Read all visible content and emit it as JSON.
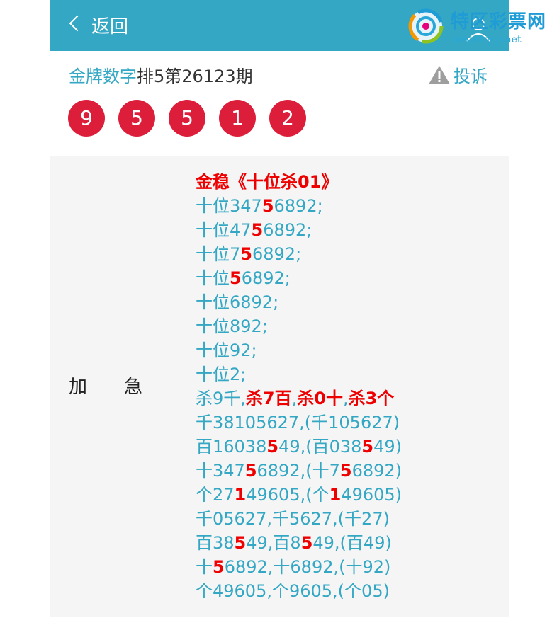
{
  "header": {
    "back_label": "返回",
    "background_color": "#33a7c3"
  },
  "logo": {
    "name": "特区彩票网",
    "url": "www.tqcp.net"
  },
  "title": {
    "brand": "金牌数字",
    "rest": "排5第26123期"
  },
  "complain_label": "投诉",
  "balls": [
    "9",
    "5",
    "5",
    "1",
    "2"
  ],
  "ball_color": "#dc1e3a",
  "category": {
    "char1": "加",
    "char2": "急"
  },
  "lines": [
    {
      "segments": [
        {
          "t": "金稳《十位杀01》",
          "hl": true
        }
      ],
      "heading": true
    },
    {
      "segments": [
        {
          "t": "十位347"
        },
        {
          "t": "5",
          "hl": true
        },
        {
          "t": "6892;"
        }
      ]
    },
    {
      "segments": [
        {
          "t": "十位47"
        },
        {
          "t": "5",
          "hl": true
        },
        {
          "t": "6892;"
        }
      ]
    },
    {
      "segments": [
        {
          "t": "十位7"
        },
        {
          "t": "5",
          "hl": true
        },
        {
          "t": "6892;"
        }
      ]
    },
    {
      "segments": [
        {
          "t": "十位"
        },
        {
          "t": "5",
          "hl": true
        },
        {
          "t": "6892;"
        }
      ]
    },
    {
      "segments": [
        {
          "t": "十位6892;"
        }
      ]
    },
    {
      "segments": [
        {
          "t": "十位892;"
        }
      ]
    },
    {
      "segments": [
        {
          "t": "十位92;"
        }
      ]
    },
    {
      "segments": [
        {
          "t": "十位2;"
        }
      ]
    },
    {
      "segments": [
        {
          "t": "杀9千,"
        },
        {
          "t": "杀7百",
          "hl": true
        },
        {
          "t": ","
        },
        {
          "t": "杀0十",
          "hl": true
        },
        {
          "t": ","
        },
        {
          "t": "杀3个",
          "hl": true
        }
      ]
    },
    {
      "segments": [
        {
          "t": "千38105627,(千105627)"
        }
      ]
    },
    {
      "segments": [
        {
          "t": "百16038"
        },
        {
          "t": "5",
          "hl": true
        },
        {
          "t": "49,(百038"
        },
        {
          "t": "5",
          "hl": true
        },
        {
          "t": "49)"
        }
      ]
    },
    {
      "segments": [
        {
          "t": "十347"
        },
        {
          "t": "5",
          "hl": true
        },
        {
          "t": "6892,(十7"
        },
        {
          "t": "5",
          "hl": true
        },
        {
          "t": "6892)"
        }
      ]
    },
    {
      "segments": [
        {
          "t": "个27"
        },
        {
          "t": "1",
          "hl": true
        },
        {
          "t": "49605,(个"
        },
        {
          "t": "1",
          "hl": true
        },
        {
          "t": "49605)"
        }
      ]
    },
    {
      "segments": [
        {
          "t": "千05627,千5627,(千27)"
        }
      ]
    },
    {
      "segments": [
        {
          "t": "百38"
        },
        {
          "t": "5",
          "hl": true
        },
        {
          "t": "49,百8"
        },
        {
          "t": "5",
          "hl": true
        },
        {
          "t": "49,(百49)"
        }
      ]
    },
    {
      "segments": [
        {
          "t": "十"
        },
        {
          "t": "5",
          "hl": true
        },
        {
          "t": "6892,十6892,(十92)"
        }
      ]
    },
    {
      "segments": [
        {
          "t": "个49605,个9605,(个05)"
        }
      ]
    }
  ],
  "colors": {
    "text_accent": "#33a7c3",
    "highlight": "#ee0000",
    "content_bg": "#f5f5f5"
  }
}
